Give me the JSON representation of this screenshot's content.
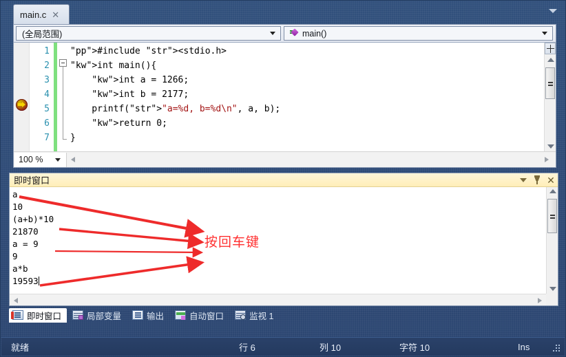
{
  "window": {
    "tabstrip": {
      "active_tab": "main.c",
      "close_glyph": "✕",
      "overflow_icon": "chevron-down-icon"
    }
  },
  "editor": {
    "navbar": {
      "scope_combo_value": "(全局范围)",
      "member_combo_value": "main()",
      "member_icon": "method-icon"
    },
    "line_numbers": [
      "1",
      "2",
      "3",
      "4",
      "5",
      "6",
      "7"
    ],
    "code_lines": [
      "#include <stdio.h>",
      "int main(){",
      "    int a = 1266;",
      "    int b = 2177;",
      "    printf(\"a=%d, b=%d\\n\", a, b);",
      "    return 0;",
      "}"
    ],
    "current_line_marker": "instruction-pointer-arrow",
    "current_line": 5,
    "zoom_level": "100 %",
    "split_view_icon": "split-editor-icon"
  },
  "immediate_window": {
    "title": "即时窗口",
    "window_menu_icon": "chevron-down-icon",
    "pin_icon": "pin-icon",
    "close_icon": "close-icon",
    "lines": [
      "a",
      "10",
      "(a+b)*10",
      "21870",
      "a = 9",
      "9",
      "a*b",
      "19593"
    ],
    "annotation": {
      "text": "按回车键",
      "color": "#ff2f2f",
      "arrow_count": 4
    }
  },
  "tool_tabs": [
    {
      "label": "即时窗口",
      "icon": "immediate-window-icon",
      "active": true
    },
    {
      "label": "局部变量",
      "icon": "locals-icon",
      "active": false
    },
    {
      "label": "输出",
      "icon": "output-icon",
      "active": false
    },
    {
      "label": "自动窗口",
      "icon": "autos-icon",
      "active": false
    },
    {
      "label": "监视 1",
      "icon": "watch-icon",
      "active": false
    }
  ],
  "statusbar": {
    "status": "就绪",
    "line": "行 6",
    "column": "列 10",
    "character": "字符 10",
    "insert_mode": "Ins",
    "grip_icon": "resize-grip-icon"
  },
  "colors": {
    "chrome": "#2d4a72",
    "statusbar": "#263c62",
    "immediate_title": "#ffeeb8",
    "annotation_red": "#ff2f2f",
    "keyword_blue": "#0000ff",
    "string_red": "#a31515",
    "linenum_teal": "#2b91af",
    "changebar_green": "#7fe07f"
  }
}
